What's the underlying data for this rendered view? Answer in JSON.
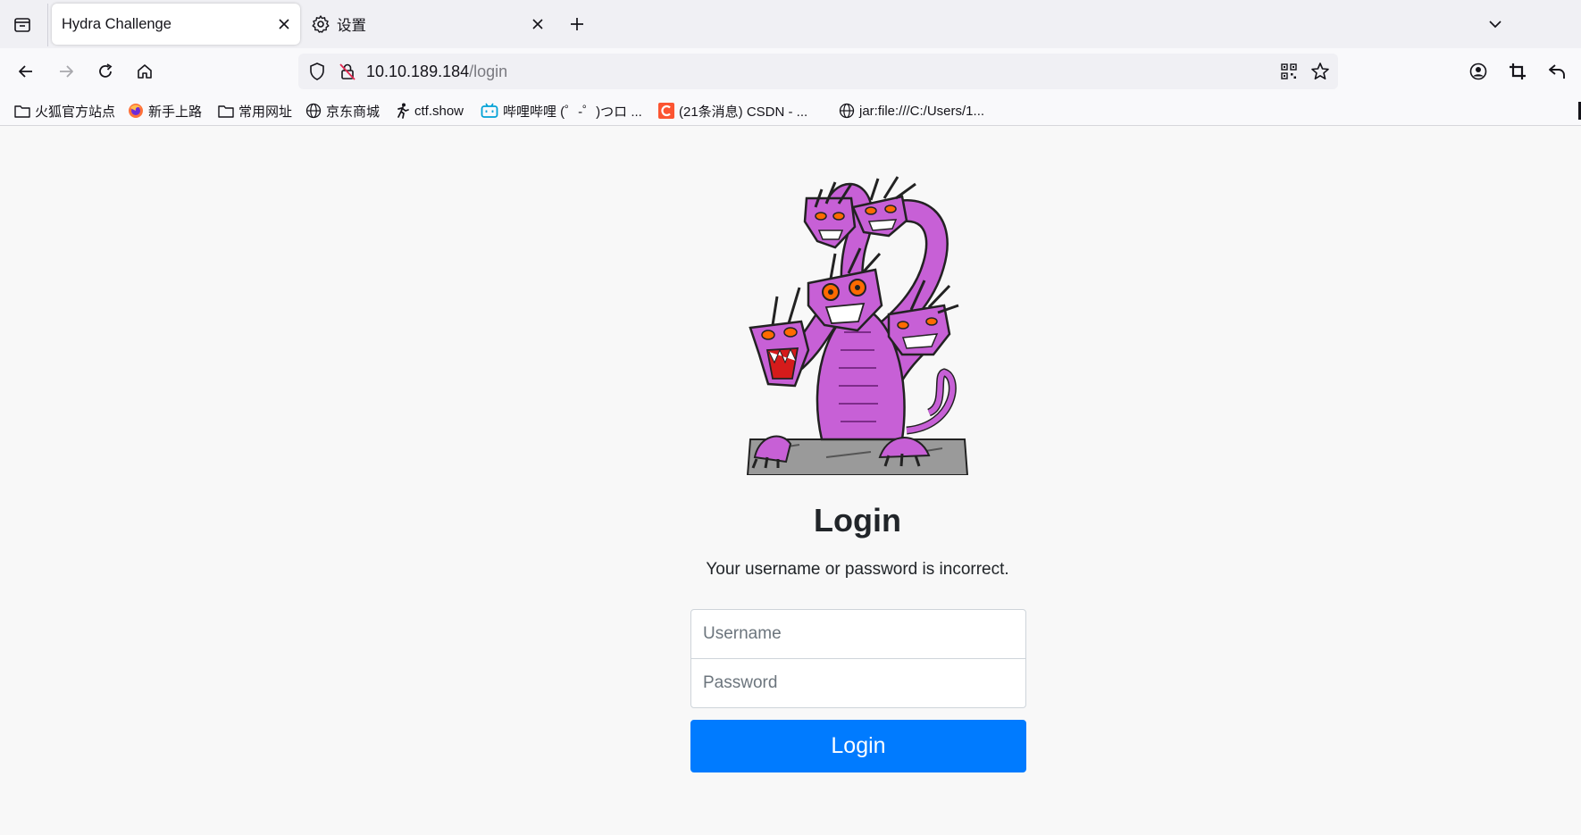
{
  "browser": {
    "tabs": [
      {
        "title": "Hydra Challenge",
        "active": true
      },
      {
        "title": "设置",
        "icon": "gear-icon",
        "active": false
      }
    ],
    "url": {
      "host": "10.10.189.184",
      "path": "/login"
    },
    "bookmarks": [
      {
        "label": "火狐官方站点",
        "icon": "folder-icon"
      },
      {
        "label": "新手上路",
        "icon": "firefox-icon"
      },
      {
        "label": "常用网址",
        "icon": "folder-icon"
      },
      {
        "label": "京东商城",
        "icon": "globe-icon"
      },
      {
        "label": "ctf.show",
        "icon": "runner-icon"
      },
      {
        "label": "哔哩哔哩 (゜-゜)つロ ...",
        "icon": "bilibili-icon"
      },
      {
        "label": "(21条消息) CSDN - ...",
        "icon": "csdn-icon"
      },
      {
        "label": "jar:file:///C:/Users/1...",
        "icon": "globe-icon"
      }
    ]
  },
  "page": {
    "heading": "Login",
    "error": "Your username or password is incorrect.",
    "username_placeholder": "Username",
    "password_placeholder": "Password",
    "submit_label": "Login"
  },
  "colors": {
    "primary": "#007bff",
    "hydra_body": "#c760d6",
    "hydra_eyes": "#ff6a00"
  }
}
